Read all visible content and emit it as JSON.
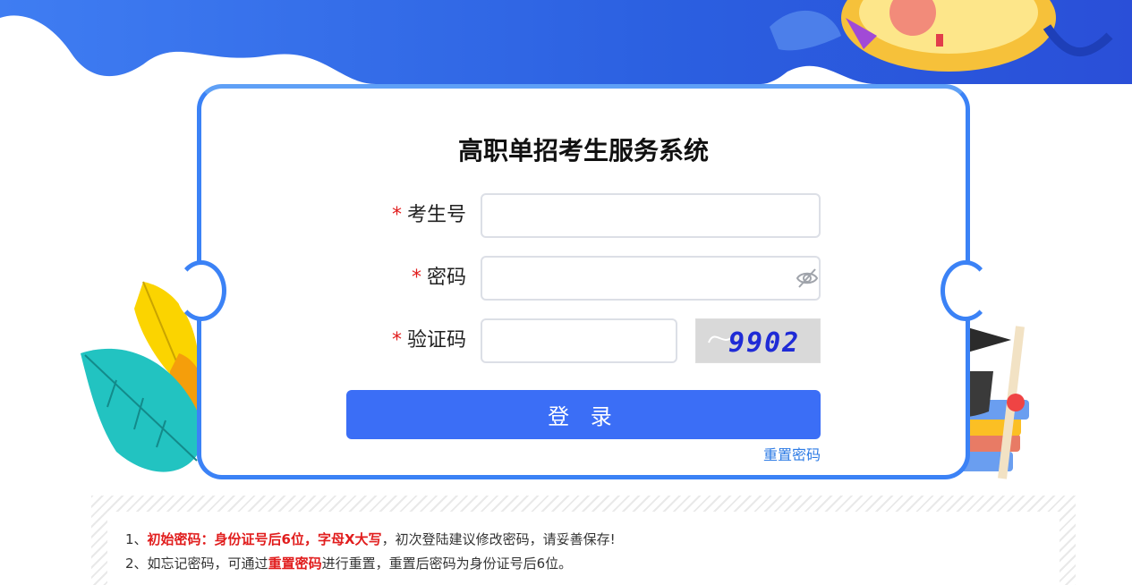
{
  "page": {
    "title": "高职单招考生服务系统"
  },
  "form": {
    "exam_no": {
      "label": "考生号",
      "required_mark": "*",
      "value": "",
      "placeholder": ""
    },
    "password": {
      "label": "密码",
      "required_mark": "*",
      "value": "",
      "placeholder": "",
      "icon": "eye-off-icon"
    },
    "captcha": {
      "label": "验证码",
      "required_mark": "*",
      "value": "",
      "placeholder": "",
      "image_text": "9902"
    },
    "login_label": "登 录",
    "reset_link": "重置密码"
  },
  "notices": [
    {
      "num": "1、",
      "highlight": "初始密码：身份证号后6位，字母X大写",
      "rest": "，初次登陆建议修改密码，请妥善保存!"
    },
    {
      "num": "2、",
      "pre": "如忘记密码，可通过",
      "highlight": "重置密码",
      "rest": "进行重置，重置后密码为身份证号后6位。"
    }
  ],
  "colors": {
    "primary": "#3b6ef6",
    "card_border": "#3b82f6",
    "required": "#e11d1d",
    "link": "#2d7be5"
  }
}
